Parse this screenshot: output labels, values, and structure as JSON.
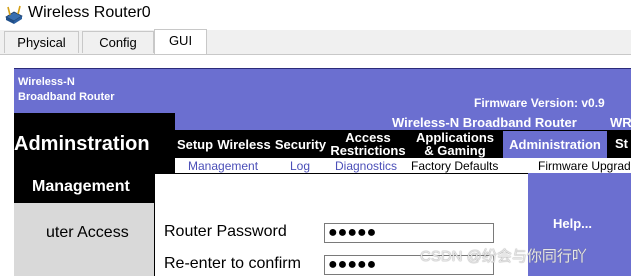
{
  "window": {
    "title": "Wireless Router0",
    "tabs": [
      {
        "label": "Physical",
        "active": false
      },
      {
        "label": "Config",
        "active": false
      },
      {
        "label": "GUI",
        "active": true
      }
    ]
  },
  "router": {
    "brand_line1": "Wireless-N",
    "brand_line2": "Broadband Router",
    "firmware": "Firmware Version: v0.9",
    "product_name": "Wireless-N Broadband Router",
    "product_short": "WR",
    "section_title": "Adminstration",
    "nav": [
      {
        "label": "Setup"
      },
      {
        "label": "Wireless"
      },
      {
        "label": "Security"
      },
      {
        "label_line1": "Access",
        "label_line2": "Restrictions"
      },
      {
        "label_line1": "Applications",
        "label_line2": "& Gaming"
      },
      {
        "label": "Administration",
        "active": true
      },
      {
        "label": "St"
      }
    ],
    "subnav": [
      "Management",
      "Log",
      "Diagnostics",
      "Factory Defaults",
      "Firmware Upgrade"
    ],
    "left_heading": "Management",
    "left_label": "uter Access",
    "fields": [
      {
        "label": "Router Password",
        "value": "●●●●●"
      },
      {
        "label": "Re-enter to confirm",
        "value": "●●●●●"
      }
    ],
    "help": "Help..."
  },
  "colors": {
    "accent": "#6b6fd0",
    "dark": "#000000"
  },
  "watermark": "CSDN @纷会与你同行吖"
}
